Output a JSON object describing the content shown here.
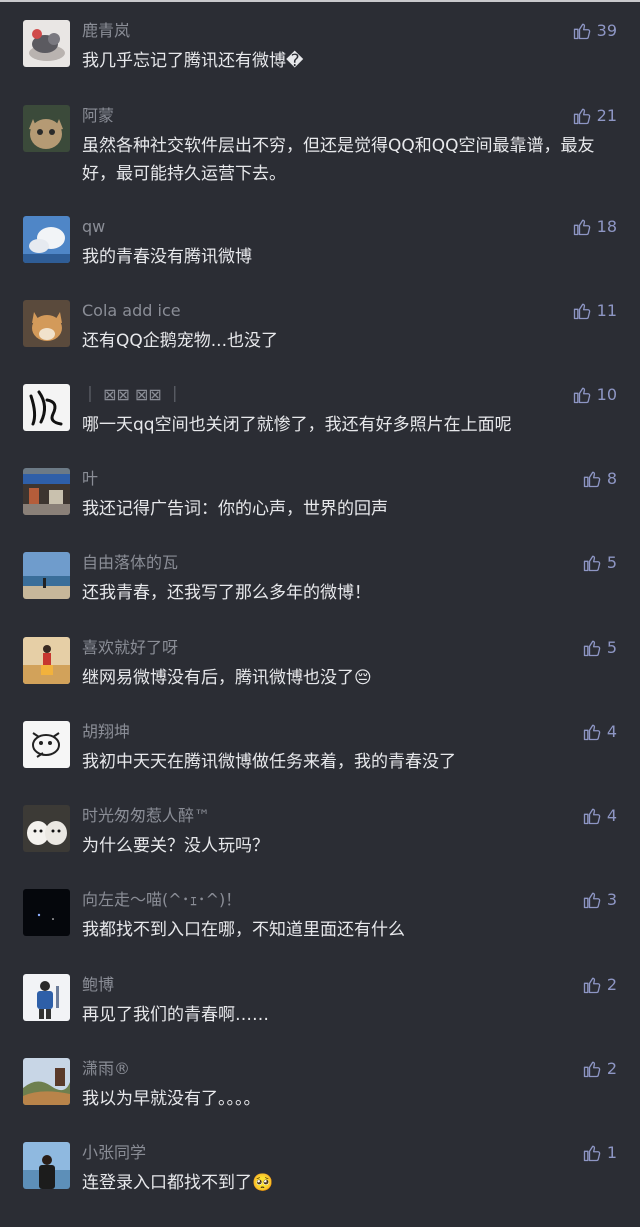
{
  "comments": [
    {
      "user": "鹿青岚",
      "text": "我几乎忘记了腾讯还有微博�",
      "likes": "39",
      "avatar": "seal-with-ball-icon"
    },
    {
      "user": "阿蒙",
      "text": "虽然各种社交软件层出不穷，但还是觉得QQ和QQ空间最靠谱，最友好，最可能持久运营下去。",
      "likes": "21",
      "avatar": "cat-icon"
    },
    {
      "user": "qw",
      "text": "我的青春没有腾讯微博",
      "likes": "18",
      "avatar": "cloud-sky-icon"
    },
    {
      "user": "Cola add ice",
      "text": "还有QQ企鹅宠物...也没了",
      "likes": "11",
      "avatar": "shiba-dog-icon"
    },
    {
      "user": "｜ ⊠⊠ ⊠⊠ ｜",
      "text": "哪一天qq空间也关闭了就惨了，我还有好多照片在上面呢",
      "likes": "10",
      "avatar": "calligraphy-icon"
    },
    {
      "user": "叶",
      "text": "我还记得广告词：你的心声，世界的回声",
      "likes": "8",
      "avatar": "street-shop-icon"
    },
    {
      "user": "自由落体的瓦",
      "text": "还我青春，还我写了那么多年的微博！",
      "likes": "5",
      "avatar": "beach-icon"
    },
    {
      "user": "喜欢就好了呀",
      "text": "继网易微博没有后，腾讯微博也没了😔",
      "likes": "5",
      "avatar": "field-person-icon"
    },
    {
      "user": "胡翔坤",
      "text": "我初中天天在腾讯微博做任务来着，我的青春没了",
      "likes": "4",
      "avatar": "doodle-face-icon"
    },
    {
      "user": "时光匆匆惹人醉™",
      "text": "为什么要关？没人玩吗？",
      "likes": "4",
      "avatar": "puppies-icon"
    },
    {
      "user": "向左走～喵(^･ｪ･^)！",
      "text": "我都找不到入口在哪，不知道里面还有什么",
      "likes": "3",
      "avatar": "dark-space-icon"
    },
    {
      "user": "鲍博",
      "text": "再见了我们的青春啊……",
      "likes": "2",
      "avatar": "backpacker-icon"
    },
    {
      "user": "潇雨®",
      "text": "我以为早就没有了。。。。",
      "likes": "2",
      "avatar": "hills-icon"
    },
    {
      "user": "小张同学",
      "text": "连登录入口都找不到了🥺",
      "likes": "1",
      "avatar": "person-beach-icon"
    }
  ],
  "colors": {
    "background": "#2b2d34",
    "username": "#8a8d96",
    "text": "#e7e8eb",
    "like_accent": "#8e96c4"
  }
}
